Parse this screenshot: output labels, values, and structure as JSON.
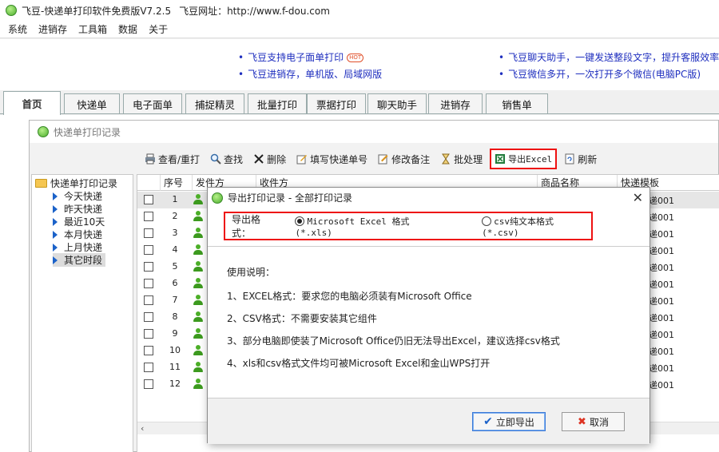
{
  "window": {
    "title": "飞豆-快递单打印软件免费版V7.2.5",
    "site": "飞豆网址：http://www.f-dou.com"
  },
  "menu": [
    "系统",
    "进销存",
    "工具箱",
    "数据",
    "关于"
  ],
  "promo": {
    "links": [
      "飞豆支持电子面单打印",
      "飞豆进销存，单机版、局域网版",
      "飞豆聊天助手，一键发送整段文字，提升客服效率",
      "飞豆微信多开，一次打开多个微信(电脑PC版)"
    ],
    "hot_badge": "HOT"
  },
  "tabs": [
    "首页",
    "快递单",
    "电子面单",
    "捕捉精灵",
    "批量打印",
    "票据打印",
    "聊天助手",
    "进销存",
    "销售单"
  ],
  "inner": {
    "title": "快递单打印记录",
    "toolbar": [
      "查看/重打",
      "查找",
      "删除",
      "填写快递单号",
      "修改备注",
      "批处理",
      "导出Excel",
      "刷新"
    ],
    "tree": {
      "root": "快递单打印记录",
      "items": [
        "今天快递",
        "昨天快递",
        "最近10天",
        "本月快递",
        "上月快递",
        "其它时段"
      ]
    },
    "grid": {
      "headers": [
        "序号",
        "发件方",
        "收件方",
        "商品名称",
        "快递模板"
      ],
      "rows": [
        "1",
        "2",
        "3",
        "4",
        "5",
        "6",
        "7",
        "8",
        "9",
        "10",
        "11",
        "12"
      ],
      "template_value": "递001"
    }
  },
  "dialog": {
    "title": "导出打印记录 - 全部打印记录",
    "format_label": "导出格式：",
    "options": [
      "Microsoft Excel 格式 (*.xls)",
      "csv纯文本格式 (*.csv)"
    ],
    "usage_title": "使用说明：",
    "usage": [
      "1、EXCEL格式：要求您的电脑必须装有Microsoft Office",
      "2、CSV格式：不需要安装其它组件",
      "3、部分电脑即使装了Microsoft Office仍旧无法导出Excel，建议选择csv格式",
      "4、xls和csv格式文件均可被Microsoft Excel和金山WPS打开"
    ],
    "ok": "立即导出",
    "cancel": "取消"
  }
}
